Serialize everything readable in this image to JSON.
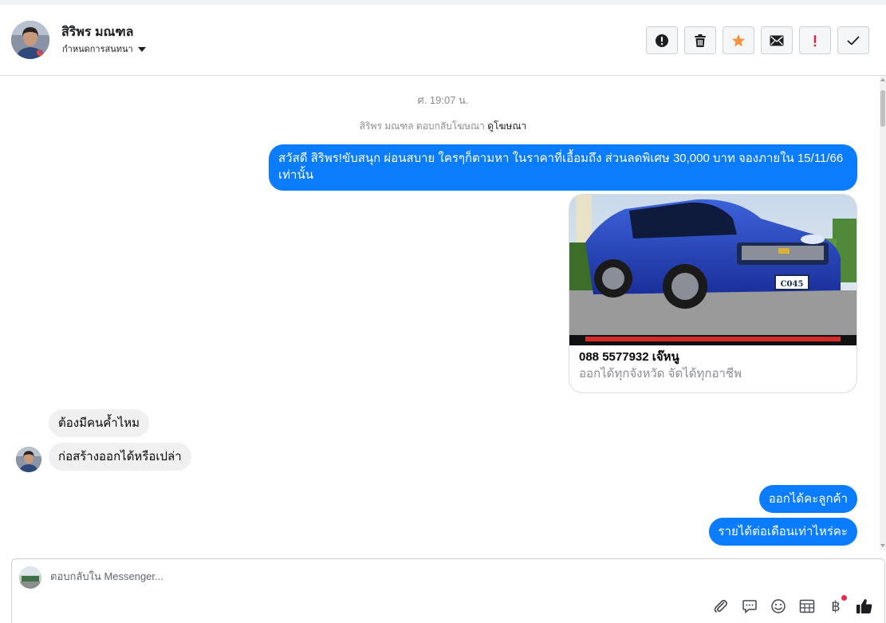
{
  "header": {
    "contact_name": "สิริพร มณฑล",
    "assign_label": "กำหนดการสนทนา",
    "toolbar": [
      {
        "name": "spam-button",
        "icon": "alert-circle-icon"
      },
      {
        "name": "delete-button",
        "icon": "trash-icon"
      },
      {
        "name": "star-button",
        "icon": "star-icon"
      },
      {
        "name": "mark-unread-button",
        "icon": "envelope-icon"
      },
      {
        "name": "follow-up-button",
        "icon": "exclamation-icon"
      },
      {
        "name": "mark-done-button",
        "icon": "check-icon"
      }
    ]
  },
  "conversation": {
    "timestamp": "ศ. 19:07 น.",
    "reply_note_prefix": "สิริพร มณฑล ตอบกลับโฆษณา",
    "reply_note_link": "ดูโฆษณา",
    "messages": [
      {
        "direction": "outgoing",
        "text": "สวัสดี สิริพร!ขับสนุก ผ่อนสบาย ใครๆก็ตามหา ในราคาที่เอื้อมถึง ส่วนลดพิเศษ 30,000 บาท จองภายใน 15/11/66 เท่านั้น"
      },
      {
        "direction": "outgoing",
        "type": "ad_card",
        "title": "088 5577932 เจ๊หนู",
        "subtitle": "ออกได้ทุกจังหวัด จัดได้ทุกอาชีพ",
        "plate": "C045"
      },
      {
        "direction": "incoming",
        "text": "ต้องมีคนค้ำไหม"
      },
      {
        "direction": "incoming",
        "text": "ก่อสร้างออกได้หรือเปล่า"
      },
      {
        "direction": "outgoing",
        "text": "ออกได้คะลูกค้า"
      },
      {
        "direction": "outgoing",
        "text": "รายได้ต่อเดือนเท่าไหร่คะ"
      }
    ]
  },
  "composer": {
    "placeholder": "ตอบกลับใน Messenger...",
    "actions": [
      "attachment-icon",
      "saved-replies-icon",
      "emoji-icon",
      "appointment-icon",
      "payment-icon",
      "like-icon"
    ],
    "payment_glyph": "฿"
  },
  "colors": {
    "outgoing_bubble": "#0a7cff",
    "incoming_bubble": "#f0f0f0",
    "star": "#f7923a",
    "follow_up": "#e41e3f",
    "notification": "#f02849"
  }
}
